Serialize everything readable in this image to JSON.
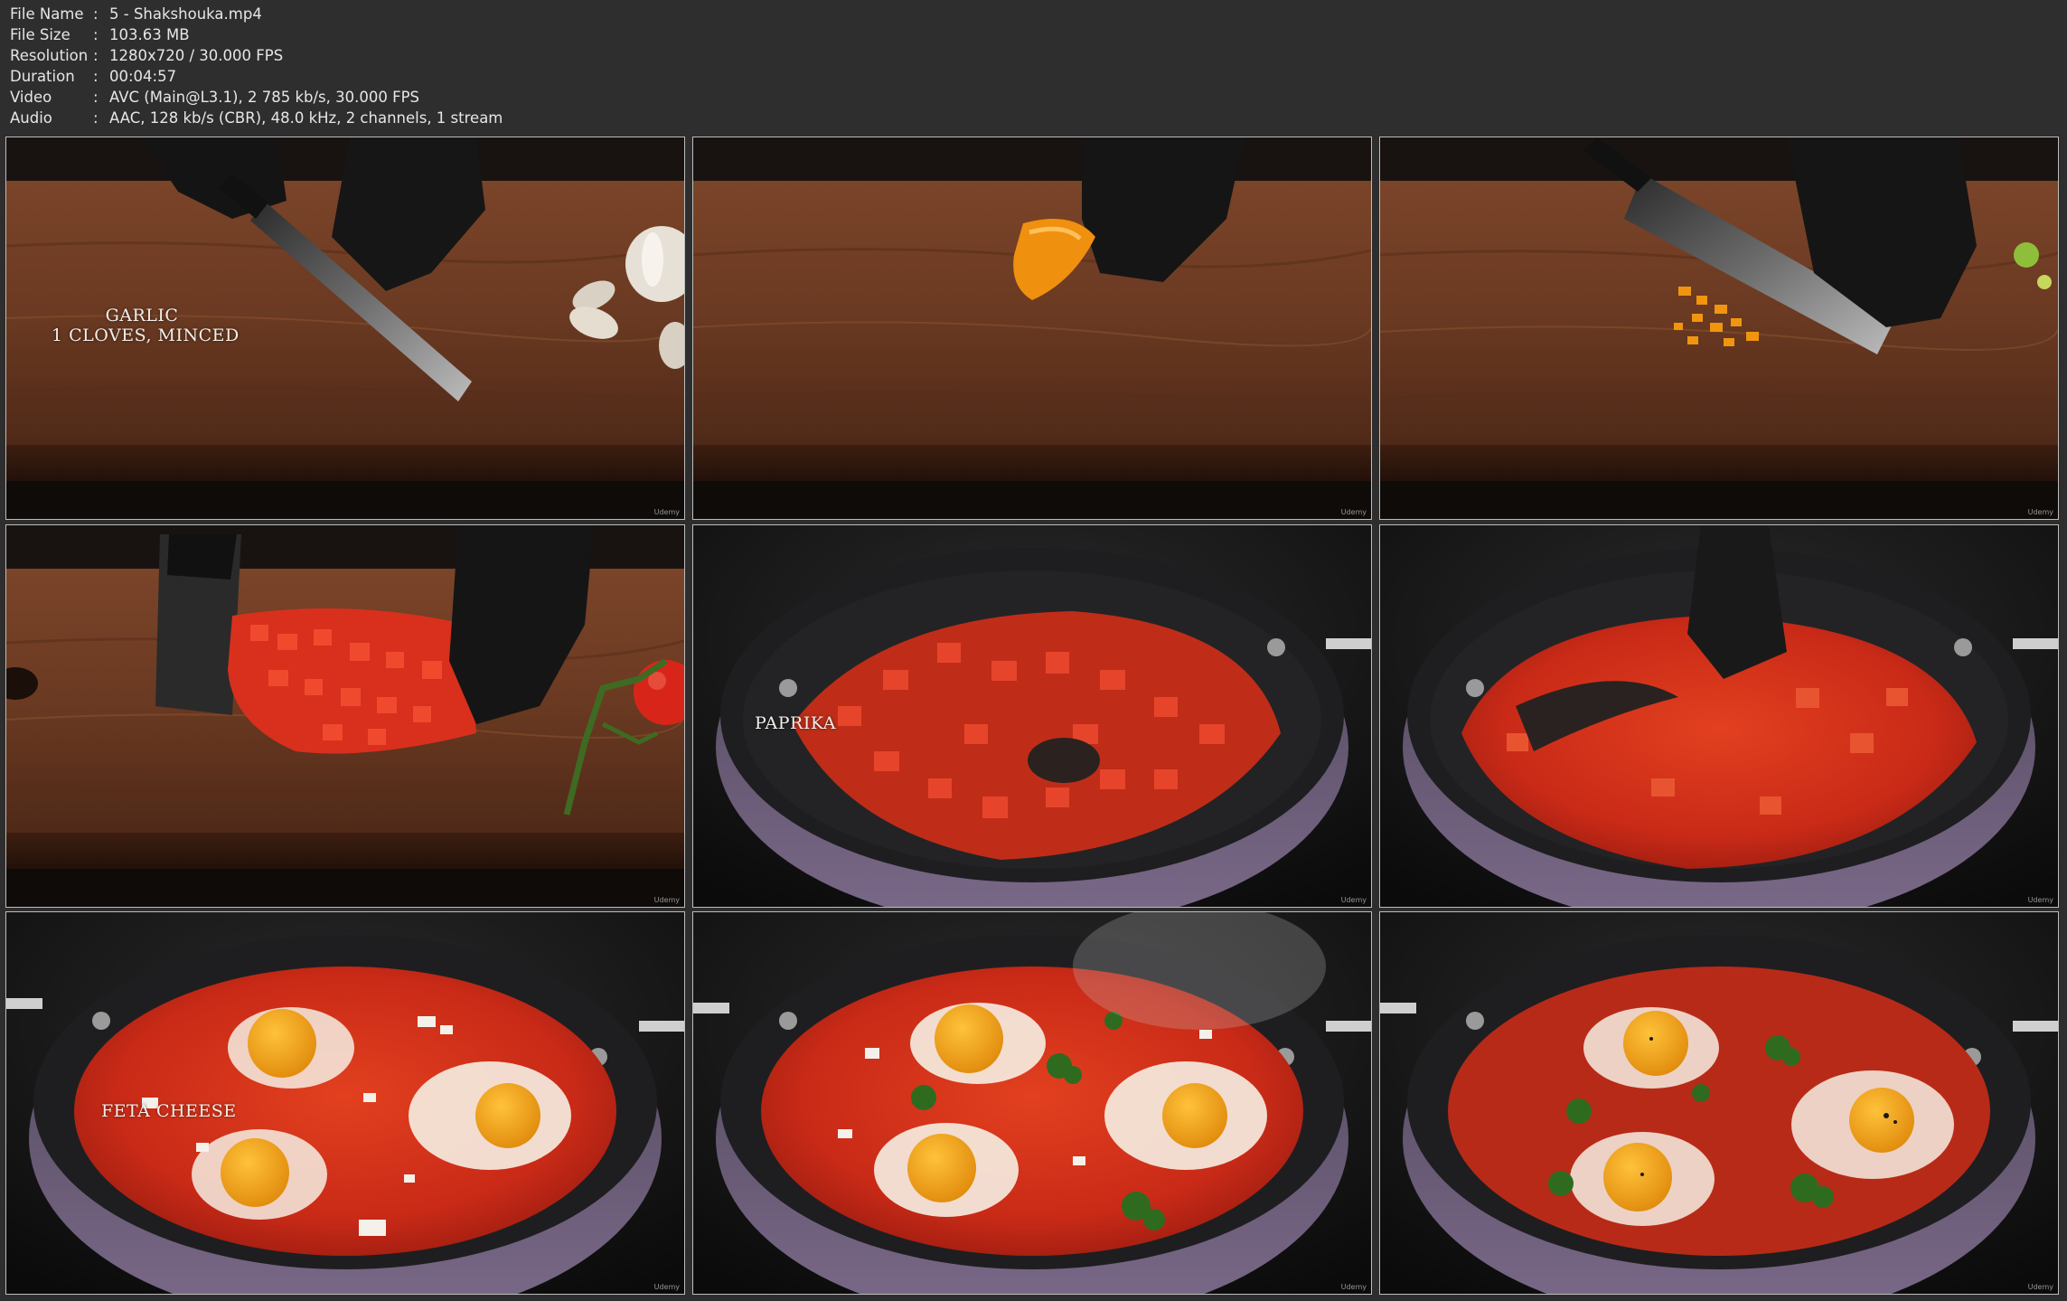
{
  "info": {
    "rows": [
      {
        "key": "File Name",
        "value": "5 - Shakshouka.mp4"
      },
      {
        "key": "File Size",
        "value": "103.63 MB"
      },
      {
        "key": "Resolution",
        "value": "1280x720 / 30.000 FPS"
      },
      {
        "key": "Duration",
        "value": "00:04:57"
      },
      {
        "key": "Video",
        "value": "AVC (Main@L3.1), 2 785 kb/s, 30.000 FPS"
      },
      {
        "key": "Audio",
        "value": "AAC, 128 kb/s (CBR), 48.0 kHz, 2 channels, 1 stream"
      }
    ],
    "separator": ":"
  },
  "thumbnails": [
    {
      "caption_line1": "Garlic",
      "caption_line2": "1 cloves, minced",
      "watermark": "Udemy"
    },
    {
      "watermark": "Udemy"
    },
    {
      "watermark": "Udemy"
    },
    {
      "watermark": "Udemy"
    },
    {
      "caption_line1": "Paprika",
      "watermark": "Udemy"
    },
    {
      "watermark": "Udemy"
    },
    {
      "caption_line1": "Feta cheese",
      "watermark": "Udemy"
    },
    {
      "watermark": "Udemy"
    },
    {
      "watermark": "Udemy"
    }
  ],
  "colors": {
    "background": "#2e2e2e",
    "board": "#6b3a22",
    "board_dark": "#4a2616",
    "pan": "#232325",
    "pan_side": "#6a5a78",
    "sauce": "#d0321c",
    "yolk": "#f0a21a",
    "glove": "#141414"
  }
}
